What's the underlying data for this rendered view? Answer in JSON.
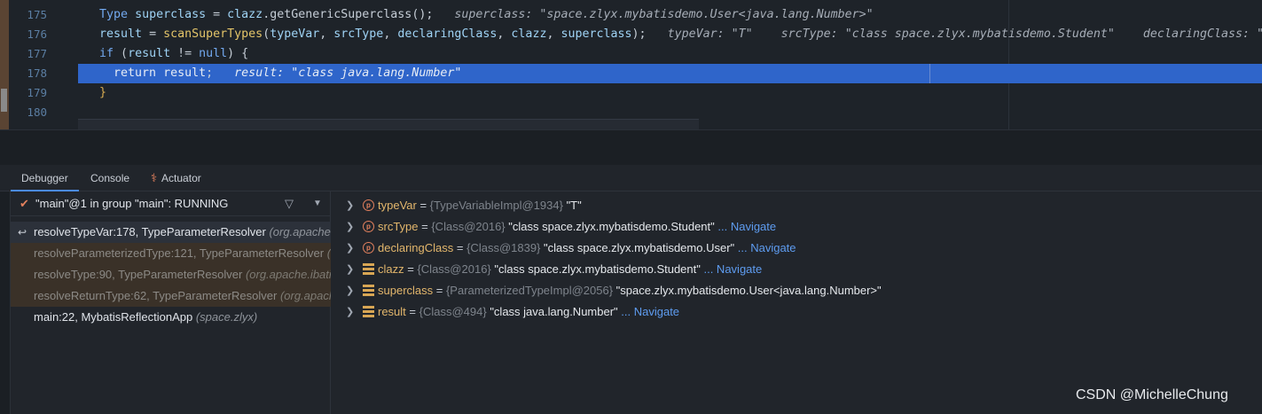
{
  "editor": {
    "line_numbers": [
      "175",
      "176",
      "177",
      "178",
      "179",
      "180"
    ],
    "lines": [
      {
        "indent": "  ",
        "segments": [
          {
            "t": "Type ",
            "c": "kw"
          },
          {
            "t": "superclass",
            "c": "vr"
          },
          {
            "t": " = ",
            "c": ""
          },
          {
            "t": "clazz",
            "c": "vr"
          },
          {
            "t": ".",
            "c": ""
          },
          {
            "t": "getGenericSuperclass",
            "c": ""
          },
          {
            "t": "();",
            "c": ""
          },
          {
            "t": "   superclass: \"space.zlyx.mybatisdemo.User<java.lang.Number>\"",
            "c": "hint"
          }
        ]
      },
      {
        "indent": "  ",
        "segments": [
          {
            "t": "result",
            "c": "vr"
          },
          {
            "t": " = ",
            "c": ""
          },
          {
            "t": "scanSuperTypes",
            "c": "fn"
          },
          {
            "t": "(",
            "c": ""
          },
          {
            "t": "typeVar",
            "c": "vr"
          },
          {
            "t": ", ",
            "c": ""
          },
          {
            "t": "srcType",
            "c": "vr"
          },
          {
            "t": ", ",
            "c": ""
          },
          {
            "t": "declaringClass",
            "c": "vr"
          },
          {
            "t": ", ",
            "c": ""
          },
          {
            "t": "clazz",
            "c": "vr"
          },
          {
            "t": ", ",
            "c": ""
          },
          {
            "t": "superclass",
            "c": "vr"
          },
          {
            "t": ");",
            "c": ""
          },
          {
            "t": "   typeVar: \"T\"    srcType: \"class space.zlyx.mybatisdemo.Student\"    declaringClass: \"class space.zl",
            "c": "hint"
          }
        ]
      },
      {
        "indent": "  ",
        "segments": [
          {
            "t": "if",
            "c": "kw"
          },
          {
            "t": " (",
            "c": ""
          },
          {
            "t": "result",
            "c": "vr"
          },
          {
            "t": " != ",
            "c": ""
          },
          {
            "t": "null",
            "c": "kw"
          },
          {
            "t": ") {",
            "c": ""
          }
        ]
      },
      {
        "indent": "    ",
        "current": true,
        "segments": [
          {
            "t": "return",
            "c": "kw"
          },
          {
            "t": " ",
            "c": ""
          },
          {
            "t": "result",
            "c": "vr"
          },
          {
            "t": ";",
            "c": ""
          },
          {
            "t": "   result: \"class java.lang.Number\"",
            "c": "hint"
          }
        ]
      },
      {
        "indent": "  ",
        "segments": [
          {
            "t": "}",
            "c": "pn"
          }
        ]
      },
      {
        "indent": "",
        "segments": []
      }
    ]
  },
  "tabs": [
    {
      "label": "Debugger",
      "active": true
    },
    {
      "label": "Console",
      "active": false
    },
    {
      "label": "Actuator",
      "active": false,
      "icon": "actuator-icon"
    }
  ],
  "thread": {
    "label": "\"main\"@1 in group \"main\": RUNNING",
    "check_icon": "✔",
    "filter_icon": "filter-icon",
    "dropdown_icon": "chevron-down-icon"
  },
  "frames": [
    {
      "method": "resolveTypeVar:178, TypeParameterResolver ",
      "pkg": "(org.apache.ibatis.reflection)",
      "kind": "sel"
    },
    {
      "method": "resolveParameterizedType:121, TypeParameterResolver ",
      "pkg": "(org.apache.ibatis.reflection)",
      "kind": "lib"
    },
    {
      "method": "resolveType:90, TypeParameterResolver ",
      "pkg": "(org.apache.ibatis.reflection)",
      "kind": "lib"
    },
    {
      "method": "resolveReturnType:62, TypeParameterResolver ",
      "pkg": "(org.apache.ibatis.reflection)",
      "kind": "lib"
    },
    {
      "method": "main:22, MybatisReflectionApp ",
      "pkg": "(space.zlyx)",
      "kind": "plain"
    }
  ],
  "variables": [
    {
      "icon": "p",
      "name": "typeVar",
      "type": "{TypeVariableImpl@1934}",
      "value": " \"T\"",
      "navigate": ""
    },
    {
      "icon": "p",
      "name": "srcType",
      "type": "{Class@2016}",
      "value": " \"class space.zlyx.mybatisdemo.Student\"",
      "navigate": " ... Navigate"
    },
    {
      "icon": "p",
      "name": "declaringClass",
      "type": "{Class@1839}",
      "value": " \"class space.zlyx.mybatisdemo.User\"",
      "navigate": " ... Navigate"
    },
    {
      "icon": "f",
      "name": "clazz",
      "type": "{Class@2016}",
      "value": " \"class space.zlyx.mybatisdemo.Student\"",
      "navigate": " ... Navigate"
    },
    {
      "icon": "f",
      "name": "superclass",
      "type": "{ParameterizedTypeImpl@2056}",
      "value": " \"space.zlyx.mybatisdemo.User<java.lang.Number>\"",
      "navigate": ""
    },
    {
      "icon": "f",
      "name": "result",
      "type": "{Class@494}",
      "value": " \"class java.lang.Number\"",
      "navigate": " ... Navigate"
    }
  ],
  "watermark": "CSDN @MichelleChung",
  "colors": {
    "selection": "#2f65ca",
    "accent": "#4b8bea",
    "param_icon": "#e2805d",
    "field_icon": "#d8a654"
  }
}
